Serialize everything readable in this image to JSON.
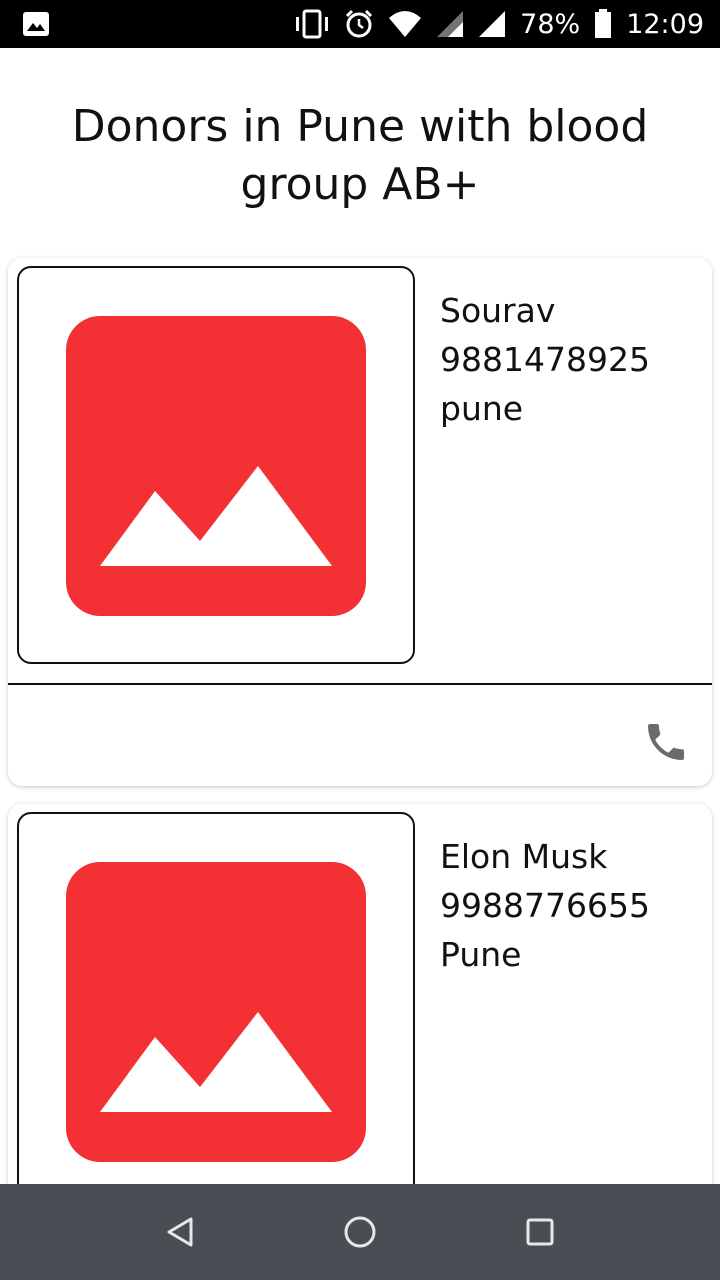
{
  "status_bar": {
    "battery": "78%",
    "time": "12:09",
    "icons": [
      "image-icon",
      "vibrate-icon",
      "alarm-icon",
      "wifi-icon",
      "signal-icon",
      "signal-icon",
      "battery-icon"
    ]
  },
  "page": {
    "title": "Donors in Pune with blood group AB+"
  },
  "donors": [
    {
      "name": "Sourav",
      "phone": "9881478925",
      "city": "pune",
      "photo_icon": "image-placeholder-icon",
      "call_icon": "phone-icon"
    },
    {
      "name": "Elon Musk",
      "phone": "9988776655",
      "city": "Pune",
      "photo_icon": "image-placeholder-icon"
    }
  ],
  "nav_bar": {
    "buttons": [
      "back-icon",
      "home-icon",
      "recents-icon"
    ]
  },
  "colors": {
    "placeholder_red": "#f33135",
    "status_bar": "#000000",
    "nav_bar": "#484e54",
    "phone_icon": "#6b6b6b"
  }
}
